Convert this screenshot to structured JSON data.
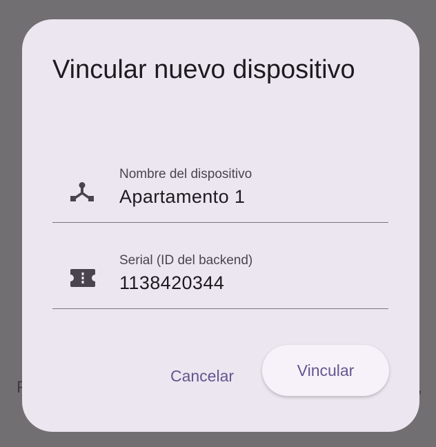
{
  "background": {
    "left_text": "P",
    "right_text": ","
  },
  "dialog": {
    "title": "Vincular nuevo dispositivo",
    "fields": [
      {
        "label": "Nombre del dispositivo",
        "value": "Apartamento 1",
        "icon": "device-hub-icon"
      },
      {
        "label": "Serial (ID del backend)",
        "value": "1138420344",
        "icon": "confirmation-number-icon"
      }
    ],
    "cancel_label": "Cancelar",
    "confirm_label": "Vincular"
  },
  "colors": {
    "scrim": "#726f73",
    "dialog_surface": "#ece6f0",
    "primary": "#65558f",
    "on_surface": "#1d1b20",
    "outline": "#79747e"
  }
}
